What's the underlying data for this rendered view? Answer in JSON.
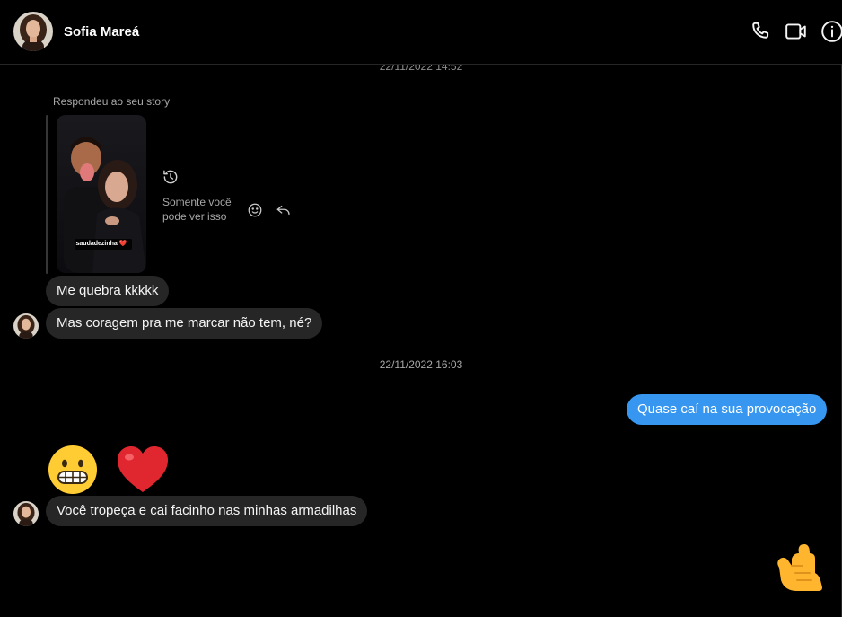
{
  "header": {
    "contact_name": "Sofia Mareá",
    "icons": [
      "phone-icon",
      "video-camera-icon",
      "info-icon"
    ]
  },
  "thread": {
    "top_timestamp": "22/11/2022 14:52",
    "story_reply_label": "Respondeu ao seu story",
    "story_caption": "saudadezinha ❤️",
    "story_privacy_note": "Somente você pode ver isso",
    "incoming_1": "Me quebra kkkkk",
    "incoming_2": "Mas coragem pra me marcar não tem, né?",
    "timestamp_2": "22/11/2022 16:03",
    "outgoing_1": "Quase caí na sua provocação",
    "emoji_message": [
      "grimacing-face",
      "red-heart"
    ],
    "incoming_3": "Você tropeça e cai facinho nas minhas armadilhas",
    "sticker": "call-me-hand"
  },
  "colors": {
    "background": "#000000",
    "incoming_bubble": "#262626",
    "outgoing_bubble": "#3797f0",
    "muted_text": "#a8a8a8"
  }
}
